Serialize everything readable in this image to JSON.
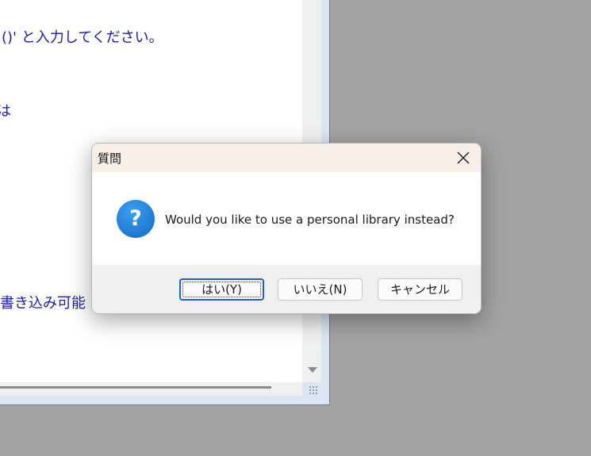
{
  "background_window": {
    "lines": [
      {
        "text": "()' と入力してください。",
        "size": "small-prefix"
      },
      {
        "text": "は"
      },
      {
        "text": "書き込み可能"
      }
    ]
  },
  "dialog": {
    "title": "質問",
    "message": "Would you like to use a personal library instead?",
    "icon": "question-icon",
    "buttons": {
      "yes": "はい(Y)",
      "no": "いいえ(N)",
      "cancel": "キャンセル"
    },
    "accent_color": "#1b63b5",
    "titlebar_color": "#f8eee8"
  }
}
